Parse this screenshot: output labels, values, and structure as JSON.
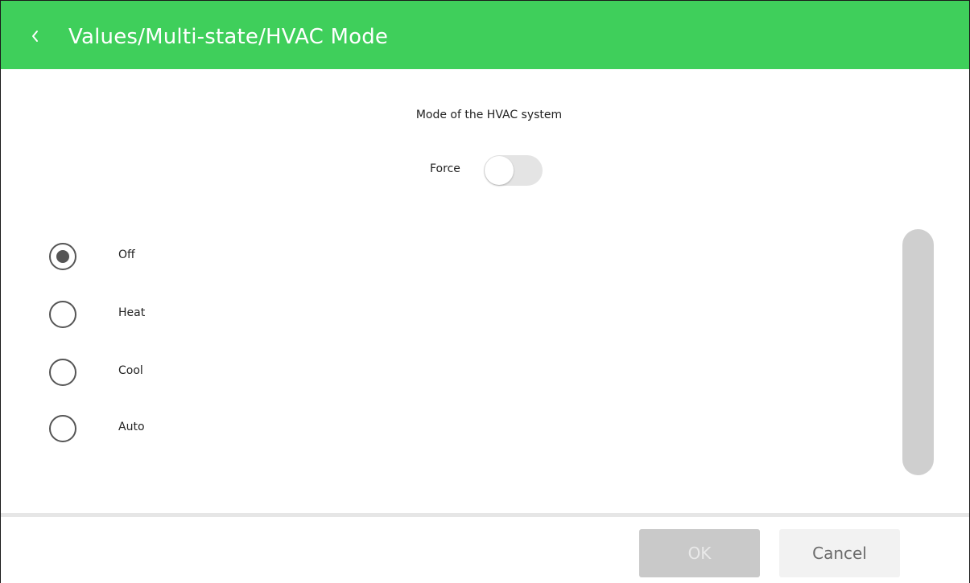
{
  "header": {
    "title": "Values/Multi-state/HVAC Mode",
    "back_icon": "chevron-left-icon",
    "background_color": "#3fcf5b"
  },
  "description": "Mode of the HVAC system",
  "force": {
    "label": "Force",
    "enabled": false
  },
  "options": [
    {
      "label": "Off",
      "selected": true
    },
    {
      "label": "Heat",
      "selected": false
    },
    {
      "label": "Cool",
      "selected": false
    },
    {
      "label": "Auto",
      "selected": false
    }
  ],
  "footer": {
    "ok_label": "OK",
    "ok_disabled": true,
    "cancel_label": "Cancel"
  }
}
